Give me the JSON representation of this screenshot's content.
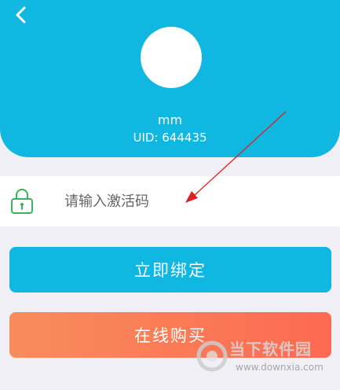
{
  "header": {
    "username": "mm",
    "uid_label": "UID:",
    "uid_value": "644435"
  },
  "activation": {
    "placeholder": "请输入激活码",
    "value": ""
  },
  "buttons": {
    "bind_label": "立即绑定",
    "buy_label": "在线购买"
  },
  "watermark": {
    "title": "当下软件园",
    "url": "www.downxia.com"
  },
  "colors": {
    "primary": "#0fb7e1",
    "buy_gradient_start": "#f78d5b",
    "buy_gradient_end": "#fd6a52",
    "lock_icon": "#3bb35a",
    "annotation_arrow": "#e02020"
  }
}
